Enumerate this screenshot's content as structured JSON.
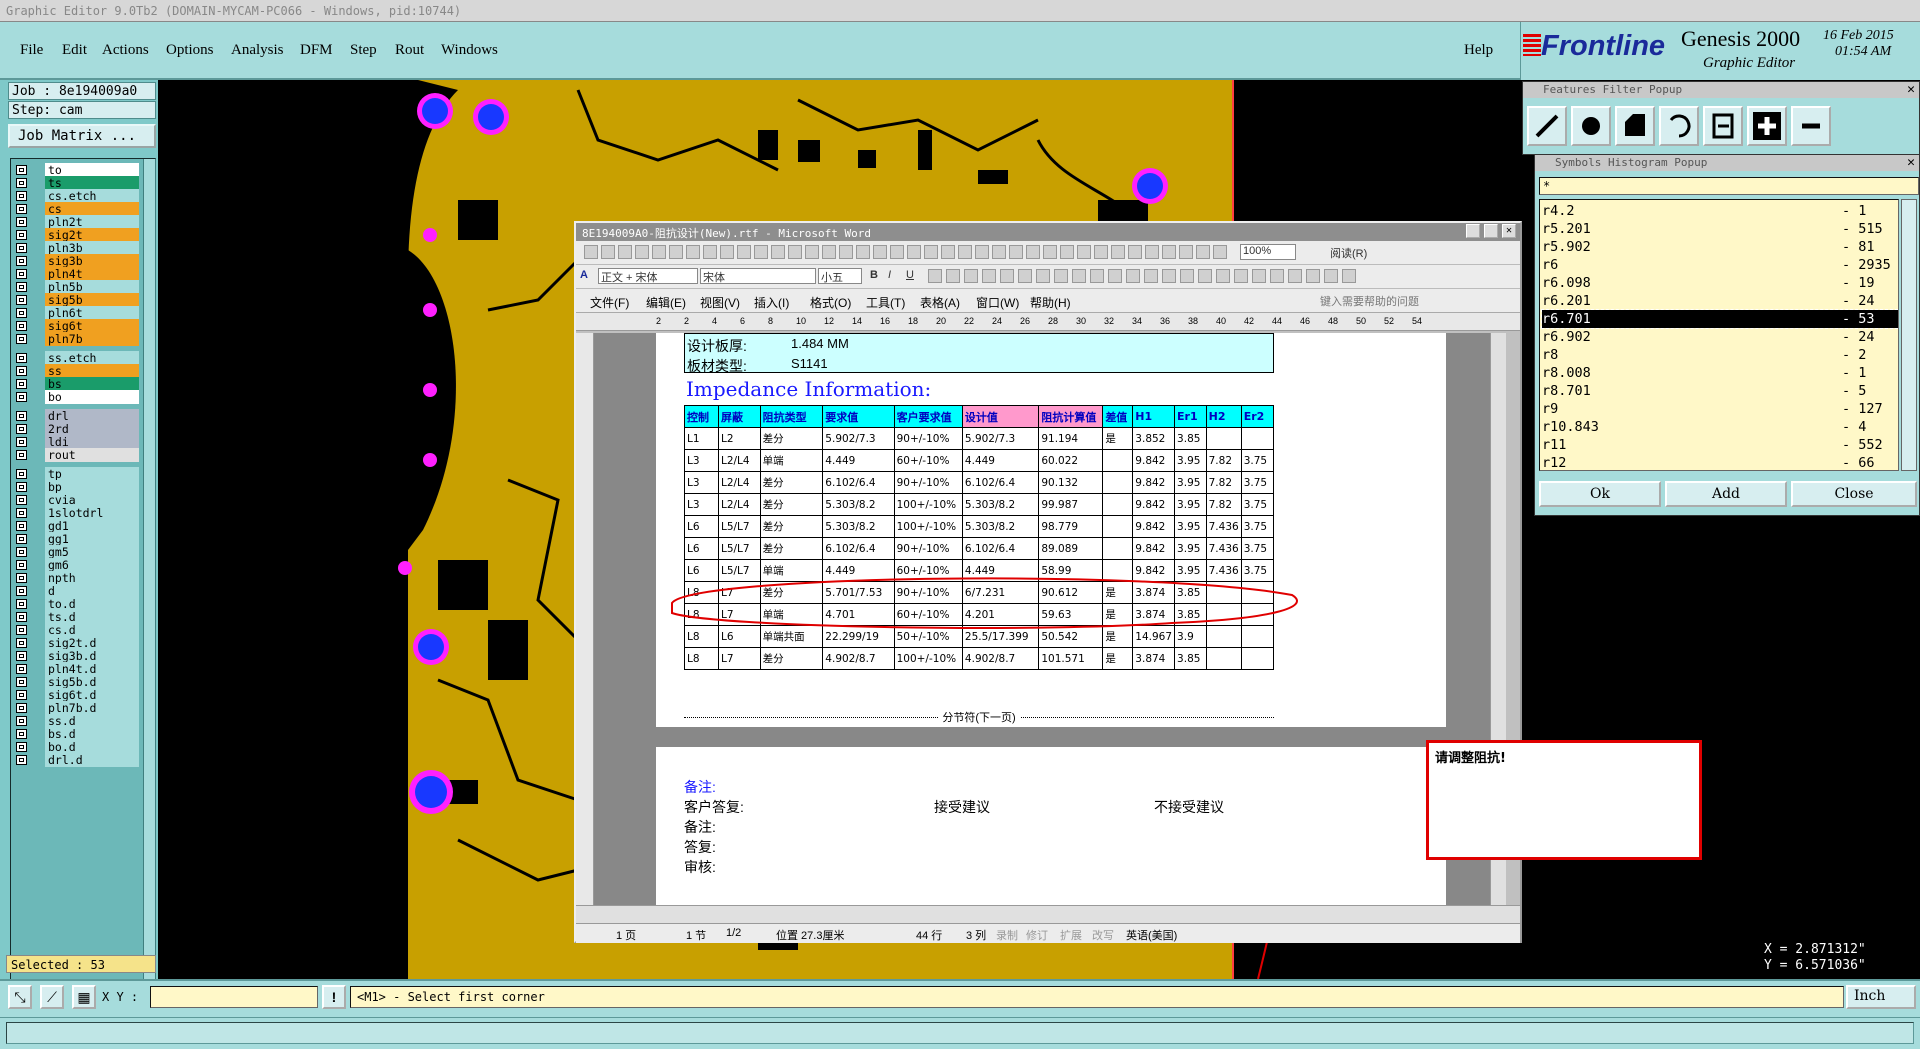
{
  "app": {
    "title": "Graphic Editor 9.0Tb2 (DOMAIN-MYCAM-PC066 - Windows, pid:10744)",
    "menu": [
      "File",
      "Edit",
      "Actions",
      "Options",
      "Analysis",
      "DFM",
      "Step",
      "Rout",
      "Windows"
    ],
    "help": "Help",
    "brand": "Frontline",
    "product": "Genesis 2000",
    "subtitle": "Graphic Editor",
    "date": "16 Feb 2015",
    "time": "01:54 AM"
  },
  "job": {
    "job_line": "Job : 8e194009a0",
    "step_line": "Step: cam",
    "matrix_button": "Job Matrix ...",
    "selected": "Selected : 53"
  },
  "layers": [
    {
      "name": "to",
      "bg": "#ffffff"
    },
    {
      "name": "ts",
      "bg": "#1a9c6a"
    },
    {
      "name": "cs.etch",
      "bg": "#a6dcdc"
    },
    {
      "name": "cs",
      "bg": "#f0a020"
    },
    {
      "name": "pln2t",
      "bg": "#a6dcdc"
    },
    {
      "name": "sig2t",
      "bg": "#f0a020"
    },
    {
      "name": "pln3b",
      "bg": "#a6dcdc"
    },
    {
      "name": "sig3b",
      "bg": "#f0a020"
    },
    {
      "name": "pln4t",
      "bg": "#f0a020"
    },
    {
      "name": "pln5b",
      "bg": "#a6dcdc"
    },
    {
      "name": "sig5b",
      "bg": "#f0a020"
    },
    {
      "name": "pln6t",
      "bg": "#a6dcdc"
    },
    {
      "name": "sig6t",
      "bg": "#f0a020"
    },
    {
      "name": "pln7b",
      "bg": "#f0a020"
    },
    {
      "name": "ss.etch",
      "bg": "#a6dcdc"
    },
    {
      "name": "ss",
      "bg": "#f0a020"
    },
    {
      "name": "bs",
      "bg": "#1a9c6a"
    },
    {
      "name": "bo",
      "bg": "#ffffff"
    },
    {
      "name": "drl",
      "bg": "#b0b8c8"
    },
    {
      "name": "2rd",
      "bg": "#b0b8c8"
    },
    {
      "name": "ldi",
      "bg": "#b0b8c8"
    },
    {
      "name": "rout",
      "bg": "#e0e0e0"
    },
    {
      "name": "tp",
      "bg": "#a6dcdc"
    },
    {
      "name": "bp",
      "bg": "#a6dcdc"
    },
    {
      "name": "cvia",
      "bg": "#a6dcdc"
    },
    {
      "name": "1slotdrl",
      "bg": "#a6dcdc"
    },
    {
      "name": "gd1",
      "bg": "#a6dcdc"
    },
    {
      "name": "gg1",
      "bg": "#a6dcdc"
    },
    {
      "name": "gm5",
      "bg": "#a6dcdc"
    },
    {
      "name": "gm6",
      "bg": "#a6dcdc"
    },
    {
      "name": "npth",
      "bg": "#a6dcdc"
    },
    {
      "name": "d",
      "bg": "#a6dcdc"
    },
    {
      "name": "to.d",
      "bg": "#a6dcdc"
    },
    {
      "name": "ts.d",
      "bg": "#a6dcdc"
    },
    {
      "name": "cs.d",
      "bg": "#a6dcdc"
    },
    {
      "name": "sig2t.d",
      "bg": "#a6dcdc"
    },
    {
      "name": "sig3b.d",
      "bg": "#a6dcdc"
    },
    {
      "name": "pln4t.d",
      "bg": "#a6dcdc"
    },
    {
      "name": "sig5b.d",
      "bg": "#a6dcdc"
    },
    {
      "name": "sig6t.d",
      "bg": "#a6dcdc"
    },
    {
      "name": "pln7b.d",
      "bg": "#a6dcdc"
    },
    {
      "name": "ss.d",
      "bg": "#a6dcdc"
    },
    {
      "name": "bs.d",
      "bg": "#a6dcdc"
    },
    {
      "name": "bo.d",
      "bg": "#a6dcdc"
    },
    {
      "name": "drl.d",
      "bg": "#a6dcdc"
    }
  ],
  "features_filter": {
    "title": "Features Filter Popup"
  },
  "histogram": {
    "title": "Symbols Histogram Popup",
    "filter": "*",
    "rows": [
      {
        "sym": "r4.2",
        "count": "- 1"
      },
      {
        "sym": "r5.201",
        "count": "- 515"
      },
      {
        "sym": "r5.902",
        "count": "- 81"
      },
      {
        "sym": "r6",
        "count": "- 2935"
      },
      {
        "sym": "r6.098",
        "count": "- 19"
      },
      {
        "sym": "r6.201",
        "count": "- 24"
      },
      {
        "sym": "r6.701",
        "count": "- 53"
      },
      {
        "sym": "r6.902",
        "count": "- 24"
      },
      {
        "sym": "r8",
        "count": "- 2"
      },
      {
        "sym": "r8.008",
        "count": "- 1"
      },
      {
        "sym": "r8.701",
        "count": "- 5"
      },
      {
        "sym": "r9",
        "count": "- 127"
      },
      {
        "sym": "r10.843",
        "count": "- 4"
      },
      {
        "sym": "r11",
        "count": "- 552"
      },
      {
        "sym": "r12",
        "count": "- 66"
      }
    ],
    "ok": "Ok",
    "add": "Add",
    "close": "Close"
  },
  "word": {
    "title": "8E194009A0-阻抗设计(New).rtf - Microsoft Word",
    "style": "正文 + 宋体",
    "font": "宋体",
    "size": "小五",
    "zoom": "100%",
    "read": "阅读(R)",
    "menu": [
      "文件(F)",
      "编辑(E)",
      "视图(V)",
      "插入(I)",
      "格式(O)",
      "工具(T)",
      "表格(A)",
      "窗口(W)",
      "帮助(H)"
    ],
    "help_placeholder": "键入需要帮助的问题",
    "ruler_marks": [
      "2",
      "2",
      "4",
      "6",
      "8",
      "10",
      "12",
      "14",
      "16",
      "18",
      "20",
      "22",
      "24",
      "26",
      "28",
      "30",
      "32",
      "34",
      "36",
      "38",
      "40",
      "42",
      "44",
      "46",
      "48",
      "50",
      "52",
      "54"
    ],
    "board_thickness_label": "设计板厚:",
    "board_thickness_value": "1.484 MM",
    "material_label": "板材类型:",
    "material_value": "S1141",
    "impedance_title": "Impedance Information:",
    "table_header": [
      "控制",
      "屏蔽",
      "阻抗类型",
      "要求值",
      "客户要求值",
      "设计值",
      "阻抗计算值",
      "差值",
      "H1",
      "Er1",
      "H2",
      "Er2"
    ],
    "table_rows": [
      [
        "L1",
        "L2",
        "差分",
        "5.902/7.3",
        "90+/-10%",
        "5.902/7.3",
        "91.194",
        "是",
        "3.852",
        "3.85",
        "",
        ""
      ],
      [
        "L3",
        "L2/L4",
        "单端",
        "4.449",
        "60+/-10%",
        "4.449",
        "60.022",
        "",
        "9.842",
        "3.95",
        "7.82",
        "3.75"
      ],
      [
        "L3",
        "L2/L4",
        "差分",
        "6.102/6.4",
        "90+/-10%",
        "6.102/6.4",
        "90.132",
        "",
        "9.842",
        "3.95",
        "7.82",
        "3.75"
      ],
      [
        "L3",
        "L2/L4",
        "差分",
        "5.303/8.2",
        "100+/-10%",
        "5.303/8.2",
        "99.987",
        "",
        "9.842",
        "3.95",
        "7.82",
        "3.75"
      ],
      [
        "L6",
        "L5/L7",
        "差分",
        "5.303/8.2",
        "100+/-10%",
        "5.303/8.2",
        "98.779",
        "",
        "9.842",
        "3.95",
        "7.436",
        "3.75"
      ],
      [
        "L6",
        "L5/L7",
        "差分",
        "6.102/6.4",
        "90+/-10%",
        "6.102/6.4",
        "89.089",
        "",
        "9.842",
        "3.95",
        "7.436",
        "3.75"
      ],
      [
        "L6",
        "L5/L7",
        "单端",
        "4.449",
        "60+/-10%",
        "4.449",
        "58.99",
        "",
        "9.842",
        "3.95",
        "7.436",
        "3.75"
      ],
      [
        "L8",
        "L7",
        "差分",
        "5.701/7.53",
        "90+/-10%",
        "6/7.231",
        "90.612",
        "是",
        "3.874",
        "3.85",
        "",
        ""
      ],
      [
        "L8",
        "L7",
        "单端",
        "4.701",
        "60+/-10%",
        "4.201",
        "59.63",
        "是",
        "3.874",
        "3.85",
        "",
        ""
      ],
      [
        "L8",
        "L6",
        "单端共面",
        "22.299/19",
        "50+/-10%",
        "25.5/17.399",
        "50.542",
        "是",
        "14.967",
        "3.9",
        "",
        ""
      ],
      [
        "L8",
        "L7",
        "差分",
        "4.902/8.7",
        "100+/-10%",
        "4.902/8.7",
        "101.571",
        "是",
        "3.874",
        "3.85",
        "",
        ""
      ]
    ],
    "section_break": "分节符(下一页)",
    "remark1": "备注:",
    "customer_reply": "客户答复:",
    "accept": "接受建议",
    "reject": "不接受建议",
    "remark2": "备注:",
    "reply": "答复:",
    "review": "审核:",
    "status": [
      "1 页",
      "1 节",
      "1/2",
      "位置 27.3厘米",
      "44 行",
      "3 列",
      "录制",
      "修订",
      "扩展",
      "改写",
      "英语(美国)"
    ]
  },
  "alert": {
    "text": "请调整阻抗!"
  },
  "coords": {
    "x": "X = 2.871312\"",
    "y": "Y = 6.571036\""
  },
  "bottom": {
    "xy_label": "X Y :",
    "message": "<M1> - Select first corner",
    "unit": "Inch"
  },
  "colors": {
    "copper": "#c8a000",
    "panel": "#a6dcdc",
    "via_outer": "#ff20ff",
    "via_inner": "#1838ff",
    "alert_border": "#e00000",
    "table_header": "#00ffff",
    "title_blue": "#1a1aff"
  }
}
